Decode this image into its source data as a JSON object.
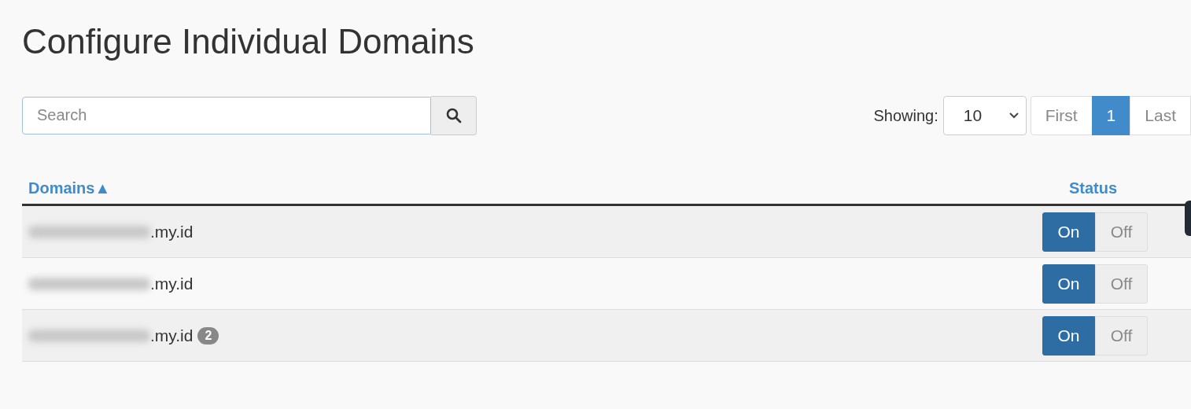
{
  "title": "Configure Individual Domains",
  "search": {
    "placeholder": "Search"
  },
  "showing": {
    "label": "Showing:",
    "value": "10"
  },
  "pagination": [
    {
      "label": "First",
      "selected": false
    },
    {
      "label": "1",
      "selected": true
    },
    {
      "label": "Last",
      "selected": false
    }
  ],
  "table": {
    "columns": [
      {
        "label": "Domains",
        "sort_icon": "▲"
      },
      {
        "label": "Status"
      }
    ],
    "rows": [
      {
        "domain": ".my.id",
        "redacted": true,
        "on": true,
        "on_label": "On",
        "off_label": "Off"
      },
      {
        "domain": ".my.id",
        "redacted": true,
        "on": true,
        "on_label": "On",
        "off_label": "Off"
      },
      {
        "domain": ".my.id",
        "redacted": true,
        "badge": "2",
        "on": true,
        "on_label": "On",
        "off_label": "Off"
      }
    ]
  }
}
